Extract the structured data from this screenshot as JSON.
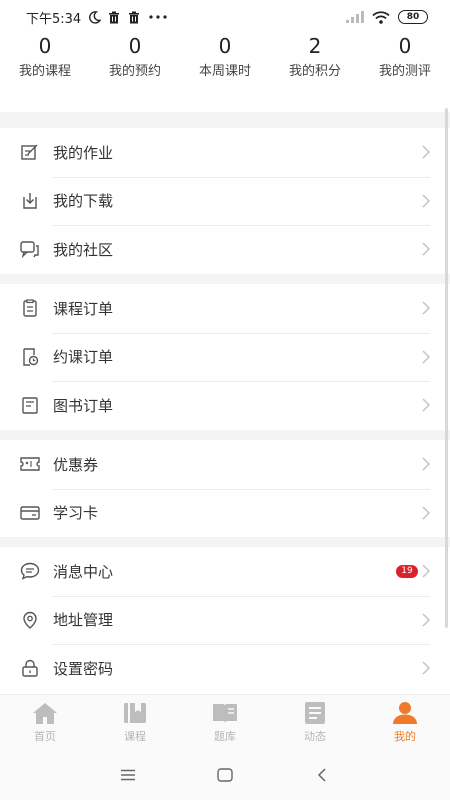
{
  "status_bar": {
    "time": "下午5:34",
    "battery": "80"
  },
  "stats": [
    {
      "value": "0",
      "label": "我的课程"
    },
    {
      "value": "0",
      "label": "我的预约"
    },
    {
      "value": "0",
      "label": "本周课时"
    },
    {
      "value": "2",
      "label": "我的积分"
    },
    {
      "value": "0",
      "label": "我的测评"
    }
  ],
  "menu": {
    "group1": [
      {
        "label": "我的作业",
        "icon": "homework-icon"
      },
      {
        "label": "我的下载",
        "icon": "download-icon"
      },
      {
        "label": "我的社区",
        "icon": "community-icon"
      }
    ],
    "group2": [
      {
        "label": "课程订单",
        "icon": "course-order-icon"
      },
      {
        "label": "约课订单",
        "icon": "booking-order-icon"
      },
      {
        "label": "图书订单",
        "icon": "book-order-icon"
      }
    ],
    "group3": [
      {
        "label": "优惠券",
        "icon": "coupon-icon"
      },
      {
        "label": "学习卡",
        "icon": "study-card-icon"
      }
    ],
    "group4": [
      {
        "label": "消息中心",
        "icon": "message-icon",
        "badge": "19"
      },
      {
        "label": "地址管理",
        "icon": "location-icon"
      },
      {
        "label": "设置密码",
        "icon": "lock-icon"
      }
    ]
  },
  "tabs": [
    {
      "label": "首页",
      "icon": "home-icon"
    },
    {
      "label": "课程",
      "icon": "course-icon"
    },
    {
      "label": "题库",
      "icon": "question-bank-icon"
    },
    {
      "label": "动态",
      "icon": "news-icon"
    },
    {
      "label": "我的",
      "icon": "profile-icon",
      "active": true
    }
  ],
  "colors": {
    "accent": "#f07a2b",
    "badge": "#d9232a",
    "inactive_tab": "#b5b5b5",
    "divider_bg": "#f4f4f4"
  }
}
